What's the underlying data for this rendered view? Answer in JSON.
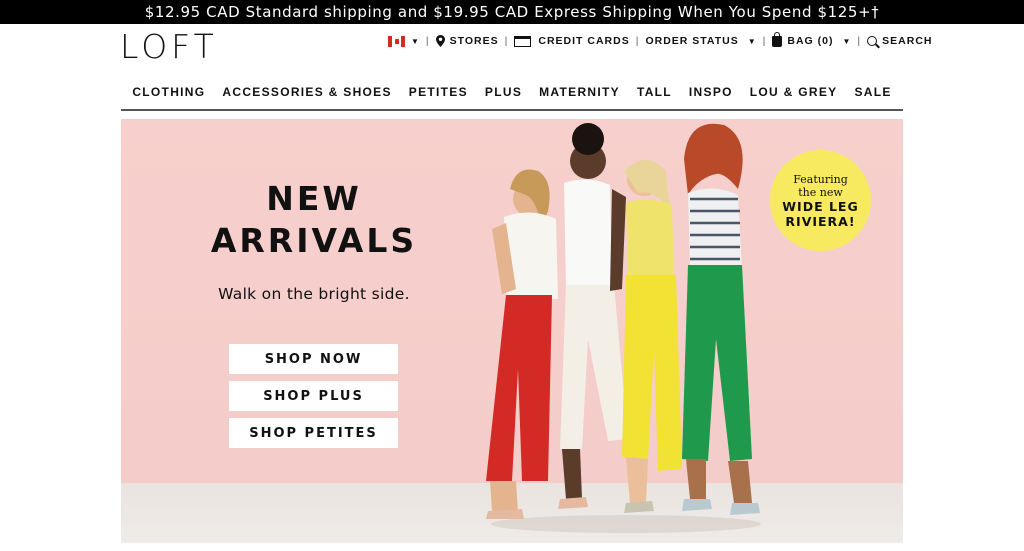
{
  "promo": {
    "text": "$12.95 CAD Standard shipping and $19.95 CAD Express Shipping When You Spend $125+†"
  },
  "brand": {
    "logo": "LOFT"
  },
  "utility": {
    "stores": "STORES",
    "credit_cards": "CREDIT CARDS",
    "order_status": "ORDER STATUS",
    "bag": "BAG (0)",
    "search": "SEARCH",
    "separator": "|"
  },
  "nav": {
    "items": [
      "CLOTHING",
      "ACCESSORIES & SHOES",
      "PETITES",
      "PLUS",
      "MATERNITY",
      "TALL",
      "INSPO",
      "LOU & GREY",
      "SALE"
    ]
  },
  "hero": {
    "title_line1": "NEW",
    "title_line2": "ARRIVALS",
    "subtitle": "Walk on the bright side.",
    "cta_shop_now": "SHOP NOW",
    "cta_shop_plus": "SHOP PLUS",
    "cta_shop_petites": "SHOP PETITES",
    "badge_line1": "Featuring",
    "badge_line2": "the new",
    "badge_line3": "WIDE LEG",
    "badge_line4": "RIVIERA!"
  },
  "colors": {
    "hero_bg": "#f7d0cd",
    "badge": "#f8ea60",
    "pant_red": "#d42a25",
    "pant_white": "#f4efe6",
    "pant_yellow": "#f1e233",
    "pant_green": "#1f9a4c"
  },
  "icons": [
    "canada-flag-icon",
    "map-pin-icon",
    "credit-card-icon",
    "bag-icon",
    "search-icon",
    "chevron-down-icon"
  ]
}
